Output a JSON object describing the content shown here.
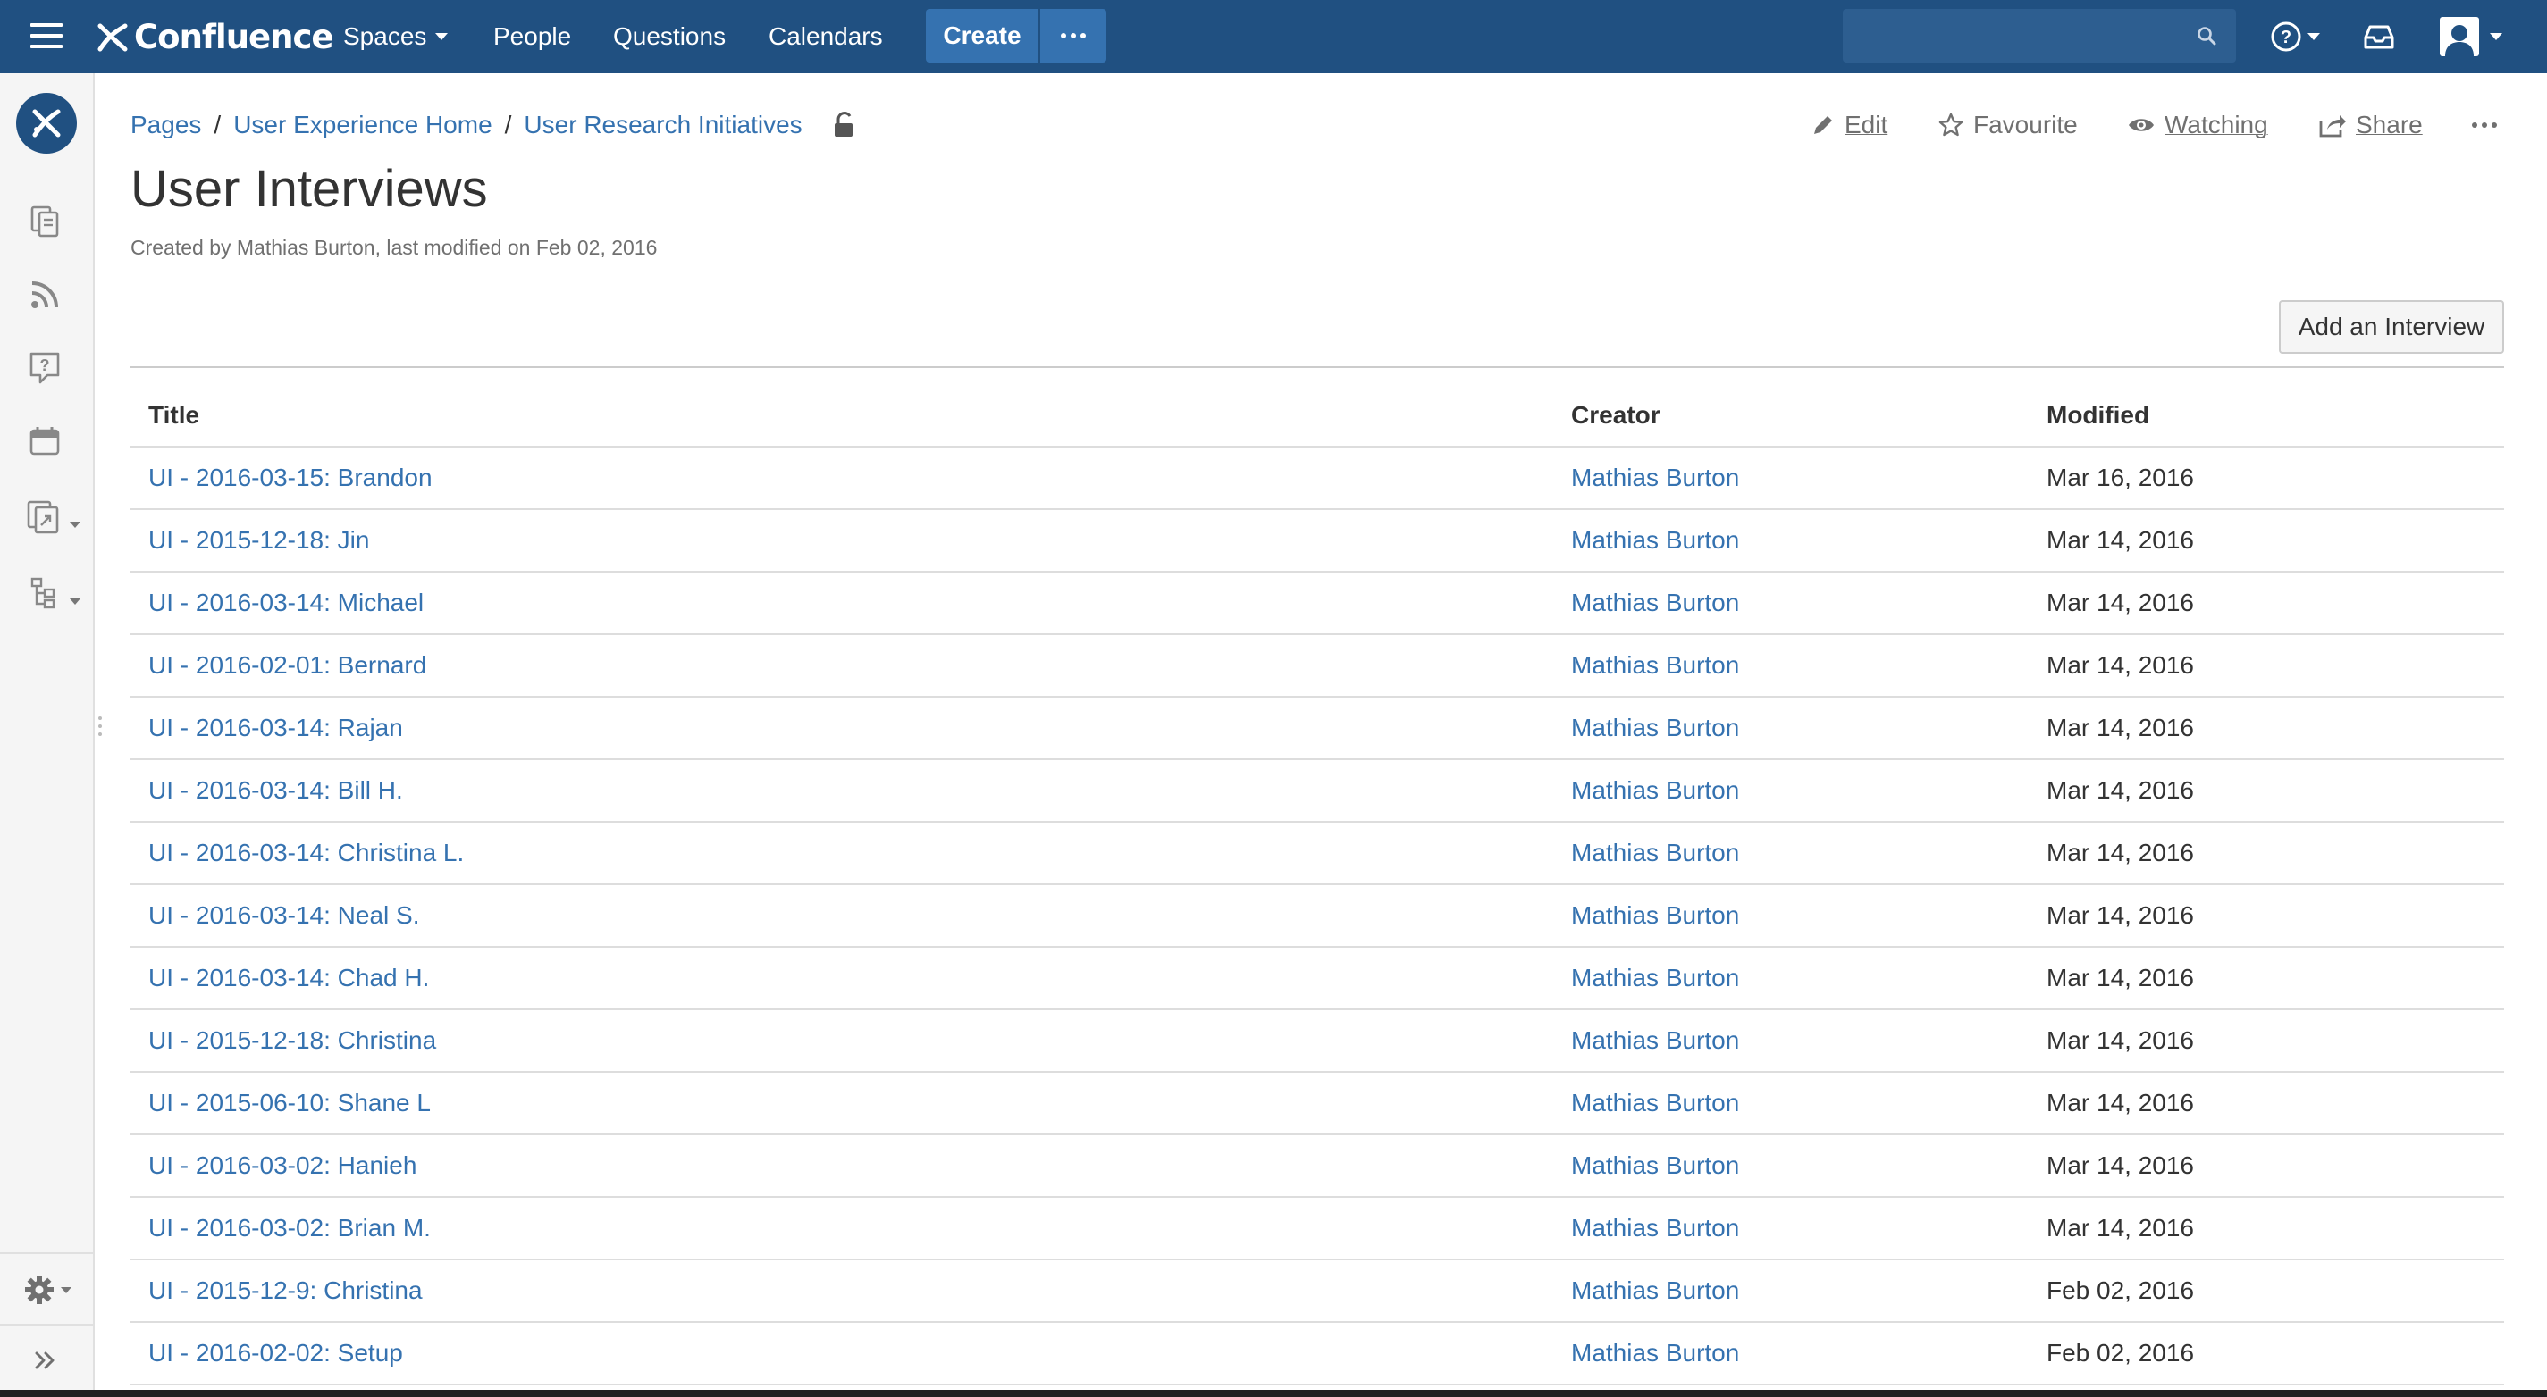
{
  "header": {
    "logo_text": "Confluence",
    "nav": [
      "Spaces",
      "People",
      "Questions",
      "Calendars"
    ],
    "create_label": "Create",
    "brand_color": "#205081",
    "accent_color": "#3572b0"
  },
  "sidebar": {
    "icons": [
      "space-logo-icon",
      "pages-icon",
      "blog-feed-icon",
      "questions-icon",
      "calendar-icon",
      "shortcuts-icon",
      "page-tree-icon",
      "settings-gear-icon",
      "expand-sidebar-icon"
    ]
  },
  "breadcrumbs": [
    "Pages",
    "User Experience Home",
    "User Research Initiatives"
  ],
  "actions": {
    "edit": "Edit",
    "favourite": "Favourite",
    "watching": "Watching",
    "share": "Share"
  },
  "page": {
    "title": "User Interviews",
    "meta": "Created by Mathias Burton, last modified on Feb 02, 2016",
    "add_button": "Add an Interview"
  },
  "table": {
    "headers": [
      "Title",
      "Creator",
      "Modified"
    ],
    "rows": [
      {
        "title": "UI - 2016-03-15: Brandon",
        "creator": "Mathias Burton",
        "modified": "Mar 16, 2016"
      },
      {
        "title": "UI - 2015-12-18: Jin",
        "creator": "Mathias Burton",
        "modified": "Mar 14, 2016"
      },
      {
        "title": "UI - 2016-03-14: Michael",
        "creator": "Mathias Burton",
        "modified": "Mar 14, 2016"
      },
      {
        "title": "UI - 2016-02-01: Bernard",
        "creator": "Mathias Burton",
        "modified": "Mar 14, 2016"
      },
      {
        "title": "UI - 2016-03-14: Rajan",
        "creator": "Mathias Burton",
        "modified": "Mar 14, 2016"
      },
      {
        "title": "UI - 2016-03-14: Bill H.",
        "creator": "Mathias Burton",
        "modified": "Mar 14, 2016"
      },
      {
        "title": "UI - 2016-03-14: Christina L.",
        "creator": "Mathias Burton",
        "modified": "Mar 14, 2016"
      },
      {
        "title": "UI - 2016-03-14: Neal S.",
        "creator": "Mathias Burton",
        "modified": "Mar 14, 2016"
      },
      {
        "title": "UI - 2016-03-14: Chad H.",
        "creator": "Mathias Burton",
        "modified": "Mar 14, 2016"
      },
      {
        "title": "UI - 2015-12-18: Christina",
        "creator": "Mathias Burton",
        "modified": "Mar 14, 2016"
      },
      {
        "title": "UI - 2015-06-10: Shane L",
        "creator": "Mathias Burton",
        "modified": "Mar 14, 2016"
      },
      {
        "title": "UI - 2016-03-02: Hanieh",
        "creator": "Mathias Burton",
        "modified": "Mar 14, 2016"
      },
      {
        "title": "UI - 2016-03-02: Brian M.",
        "creator": "Mathias Burton",
        "modified": "Mar 14, 2016"
      },
      {
        "title": "UI - 2015-12-9: Christina",
        "creator": "Mathias Burton",
        "modified": "Feb 02, 2016"
      },
      {
        "title": "UI - 2016-02-02: Setup",
        "creator": "Mathias Burton",
        "modified": "Feb 02, 2016"
      }
    ]
  }
}
